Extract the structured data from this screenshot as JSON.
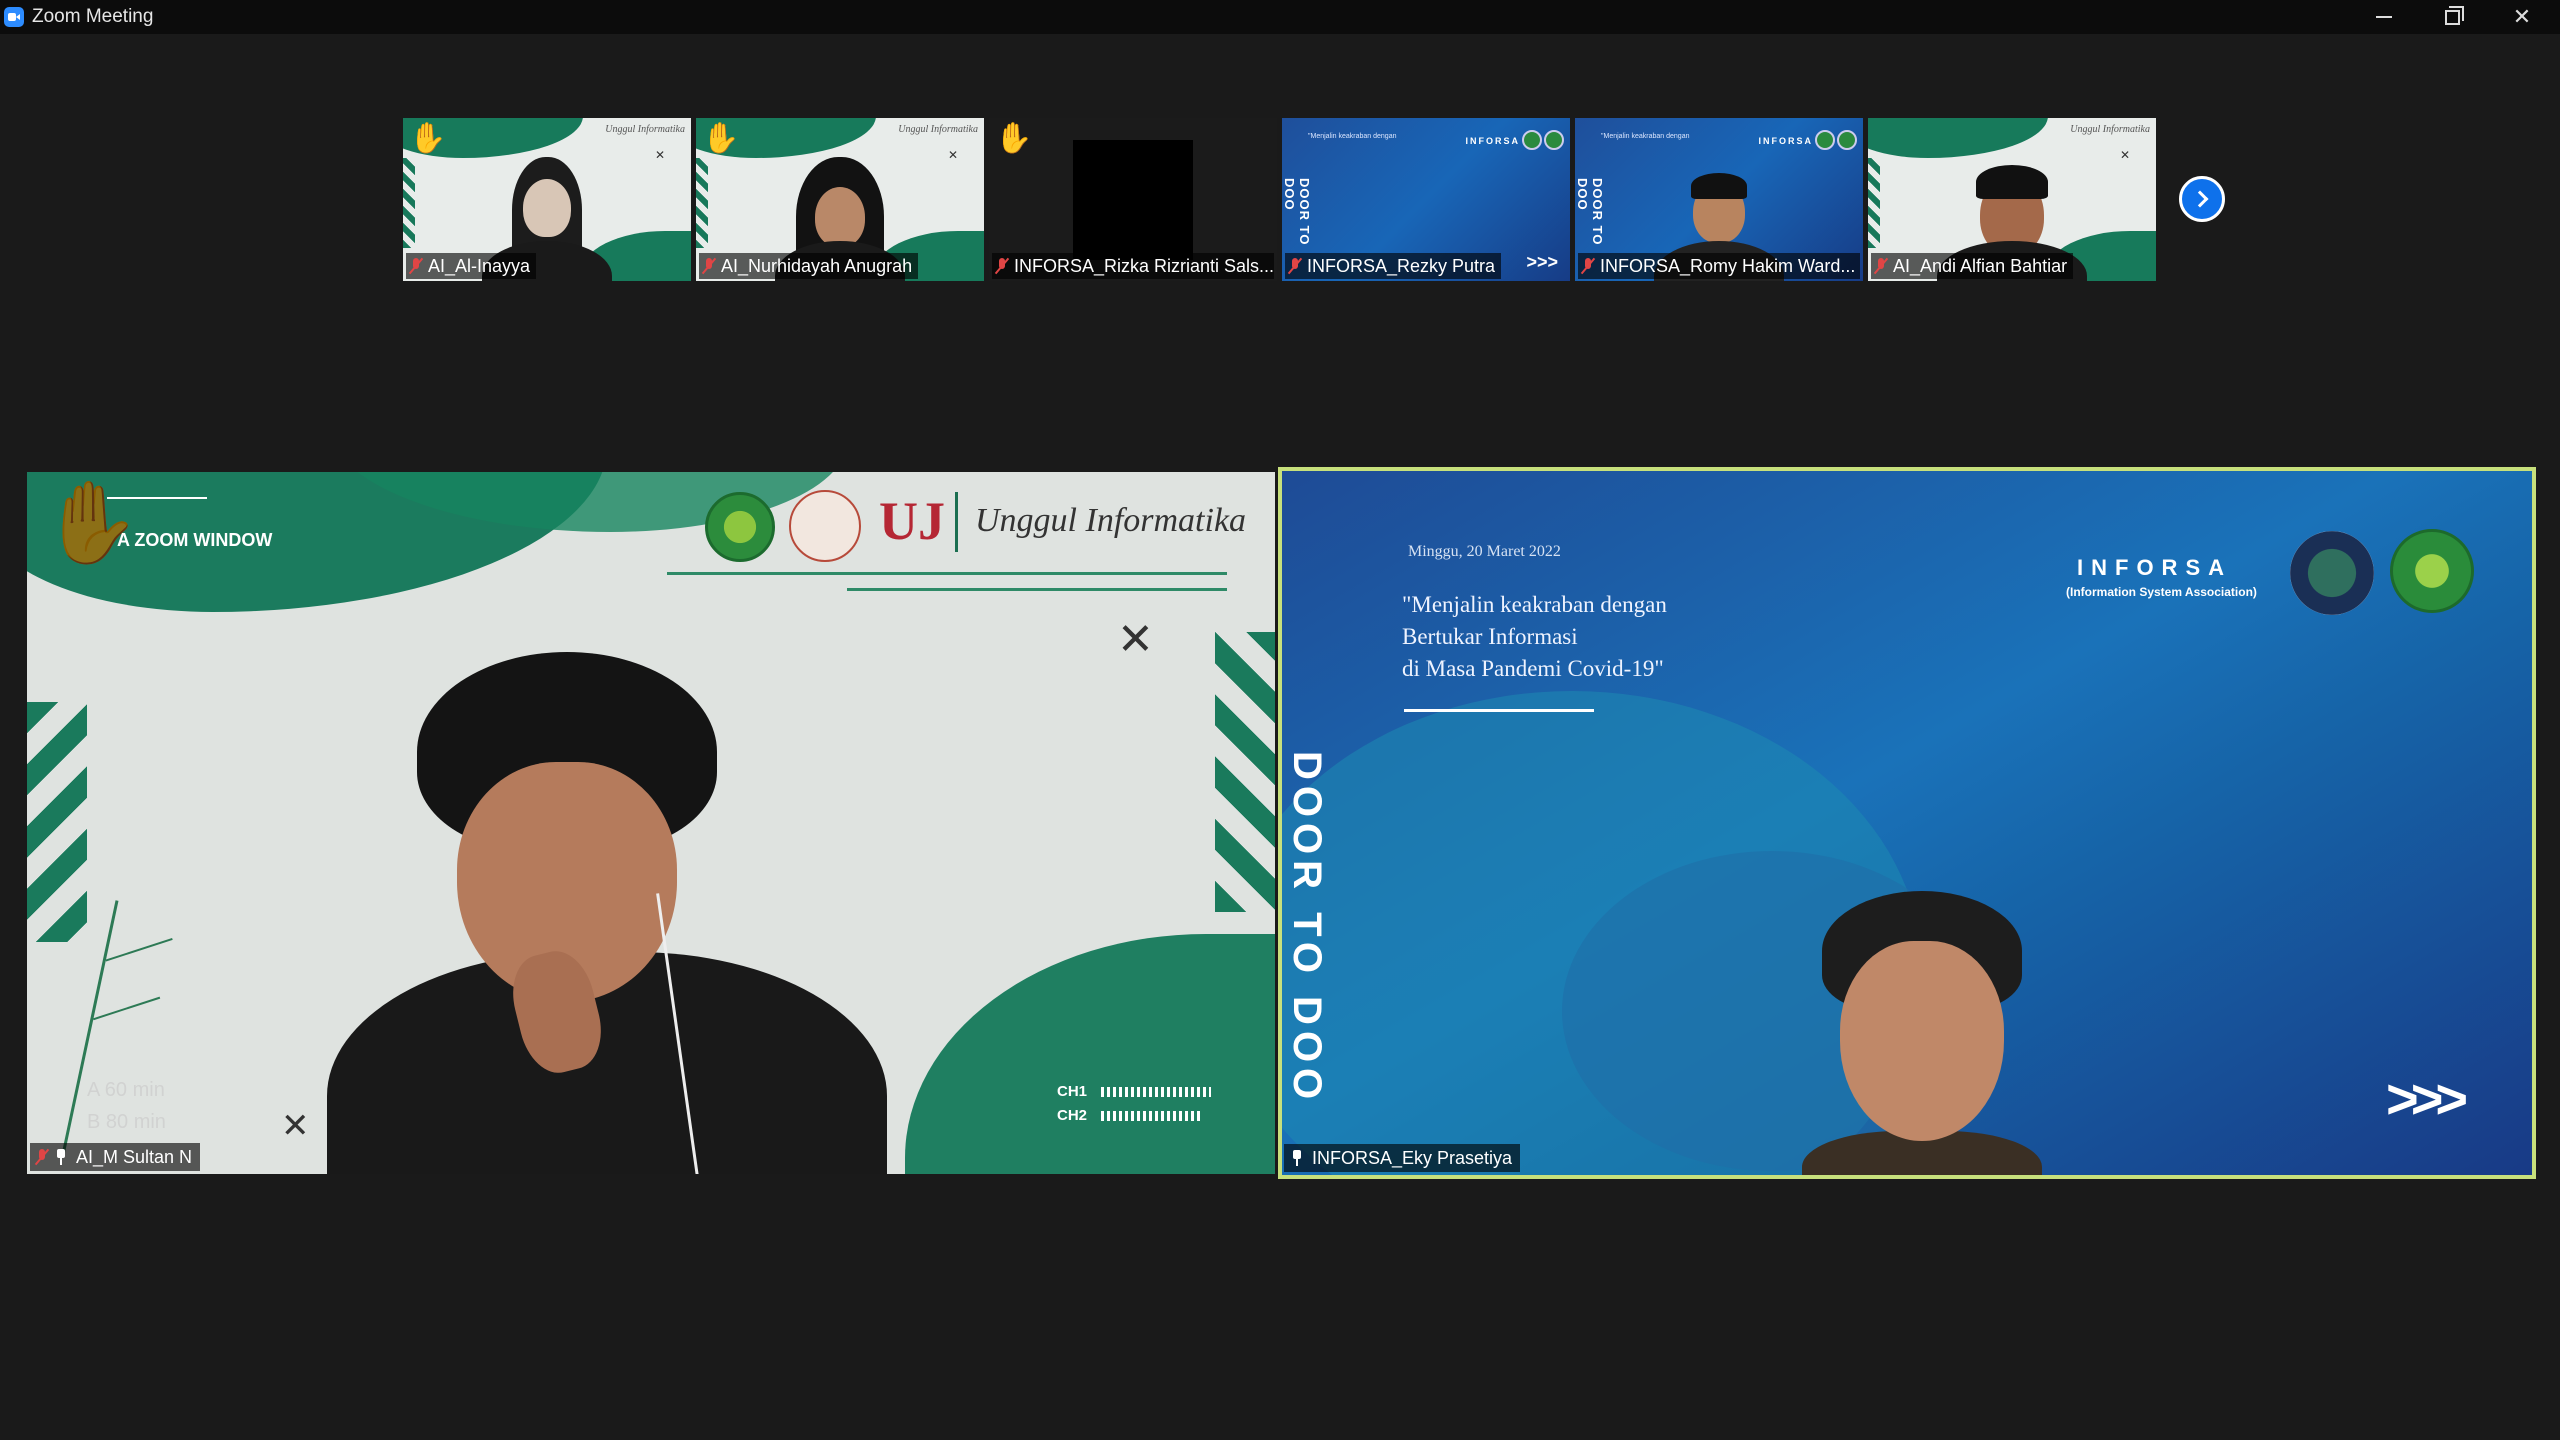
{
  "window": {
    "title": "Zoom Meeting",
    "controls": {
      "minimize_icon": "minimize-icon",
      "maximize_icon": "restore-icon",
      "close_icon": "close-icon"
    }
  },
  "gallery": {
    "thumbnails": [
      {
        "name": "AI_Al-Inayya",
        "muted": true,
        "hand_raised": true
      },
      {
        "name": "AI_Nurhidayah Anugrah",
        "muted": true,
        "hand_raised": true
      },
      {
        "name": "INFORSA_Rizka Rizrianti Sals...",
        "muted": true,
        "hand_raised": true
      },
      {
        "name": "INFORSA_Rezky Putra",
        "muted": true,
        "hand_raised": false
      },
      {
        "name": "INFORSA_Romy Hakim Ward...",
        "muted": true,
        "hand_raised": false
      },
      {
        "name": "AI_Andi Alfian Bahtiar",
        "muted": true,
        "hand_raised": false
      }
    ],
    "next_page_icon": "chevron-right-icon"
  },
  "main_left": {
    "participant": "AI_M Sultan N",
    "muted": true,
    "pinned": true,
    "hand_raised": true,
    "background": {
      "zoom_window": "A ZOOM WINDOW",
      "brand": "Unggul Informatika",
      "logo_text": "UJ",
      "timer_a": "A  60 min",
      "timer_b": "B  80 min",
      "ch1": "CH1",
      "ch2": "CH2"
    }
  },
  "main_right": {
    "participant": "INFORSA_Eky Prasetiya",
    "pinned": true,
    "active_speaker": true,
    "slide": {
      "date": "Minggu, 20 Maret 2022",
      "quote_line1": "\"Menjalin keakraban dengan",
      "quote_line2": "Bertukar Informasi",
      "quote_line3": "di Masa Pandemi Covid-19\"",
      "side_text": "DOOR TO DOO",
      "org": "INFORSA",
      "org_sub": "(Information System Association)",
      "arrows": ">>>"
    }
  },
  "colors": {
    "active_speaker_border": "#c7e07c",
    "muted_mic": "#e04545",
    "next_button": "#0e71eb"
  }
}
